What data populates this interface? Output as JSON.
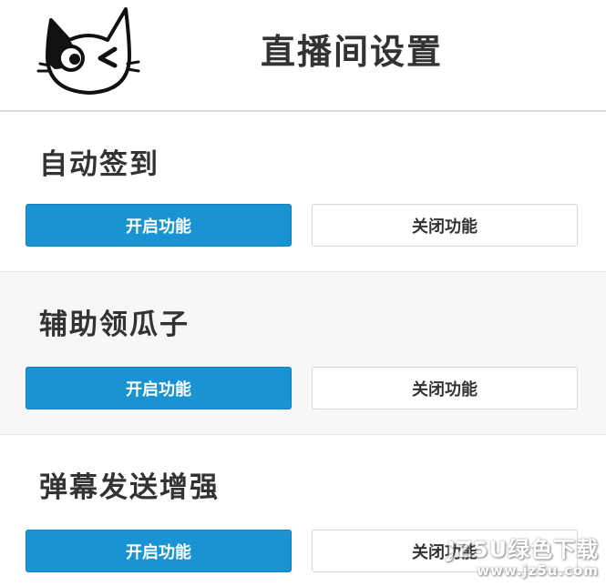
{
  "header": {
    "title": "直播间设置",
    "logo_icon": "cat-mascot-icon"
  },
  "sections": [
    {
      "title": "自动签到",
      "enable_label": "开启功能",
      "disable_label": "关闭功能"
    },
    {
      "title": "辅助领瓜子",
      "enable_label": "开启功能",
      "disable_label": "关闭功能"
    },
    {
      "title": "弹幕发送增强",
      "enable_label": "开启功能",
      "disable_label": "关闭功能"
    }
  ],
  "watermark": {
    "text": "JZ5U绿色下载",
    "url_text": "www.jz5u.com"
  },
  "colors": {
    "accent": "#1a93d3",
    "text": "#333333",
    "divider": "#dcdcdc"
  }
}
